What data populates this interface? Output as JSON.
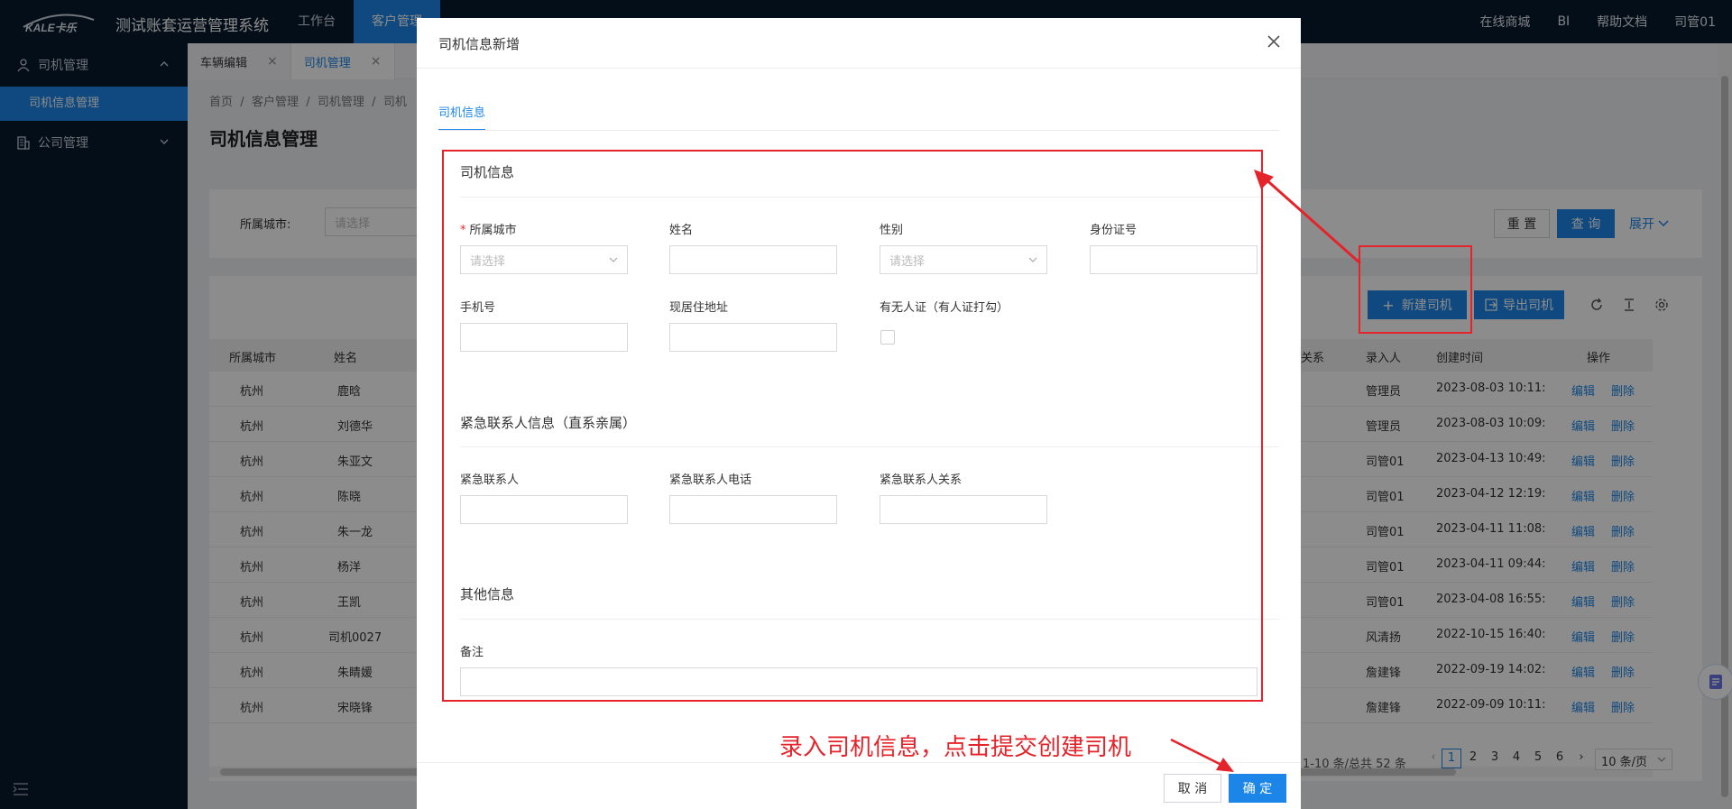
{
  "topbar": {
    "system_title": "测试账套运营管理系统",
    "nav": [
      "工作台",
      "客户管理"
    ],
    "right": [
      "在线商城",
      "BI",
      "帮助文档",
      "司管01"
    ]
  },
  "sidebar": {
    "groups": [
      {
        "label": "司机管理",
        "icon": "user-icon",
        "expanded": true,
        "children": [
          "司机信息管理"
        ]
      },
      {
        "label": "公司管理",
        "icon": "building-icon",
        "expanded": false,
        "children": []
      }
    ]
  },
  "tabs": [
    {
      "label": "车辆编辑",
      "active": false
    },
    {
      "label": "司机管理",
      "active": true
    }
  ],
  "breadcrumb": [
    "首页",
    "客户管理",
    "司机管理",
    "司机"
  ],
  "page_title": "司机信息管理",
  "filter": {
    "city_label": "所属城市:",
    "city_placeholder": "请选择",
    "reset_label": "重 置",
    "query_label": "查 询",
    "expand_label": "展开"
  },
  "toolbar": {
    "new_label": "新建司机",
    "export_label": "导出司机"
  },
  "table": {
    "headers": [
      "所属城市",
      "姓名",
      "关系",
      "录入人",
      "创建时间",
      "操作"
    ],
    "rows": [
      {
        "city": "杭州",
        "name": "鹿晗",
        "creator": "管理员",
        "created": "2023-08-03 10:11:"
      },
      {
        "city": "杭州",
        "name": "刘德华",
        "creator": "管理员",
        "created": "2023-08-03 10:09:"
      },
      {
        "city": "杭州",
        "name": "朱亚文",
        "creator": "司管01",
        "created": "2023-04-13 10:49:"
      },
      {
        "city": "杭州",
        "name": "陈晓",
        "creator": "司管01",
        "created": "2023-04-12 12:19:"
      },
      {
        "city": "杭州",
        "name": "朱一龙",
        "creator": "司管01",
        "created": "2023-04-11 11:08:"
      },
      {
        "city": "杭州",
        "name": "杨洋",
        "creator": "司管01",
        "created": "2023-04-11 09:44:"
      },
      {
        "city": "杭州",
        "name": "王凯",
        "creator": "司管01",
        "created": "2023-04-08 16:55:"
      },
      {
        "city": "杭州",
        "name": "司机0027",
        "creator": "风清扬",
        "created": "2022-10-15 16:40:"
      },
      {
        "city": "杭州",
        "name": "朱睛媛",
        "creator": "詹建锋",
        "created": "2022-09-19 14:02:"
      },
      {
        "city": "杭州",
        "name": "宋晓锋",
        "creator": "詹建锋",
        "created": "2022-09-09 10:11:"
      }
    ],
    "edit_label": "编辑",
    "delete_label": "删除"
  },
  "pagination": {
    "summary": "1-10 条/总共 52 条",
    "pages": [
      "1",
      "2",
      "3",
      "4",
      "5",
      "6"
    ],
    "current": "1",
    "page_size": "10 条/页"
  },
  "modal": {
    "title": "司机信息新增",
    "tab": "司机信息",
    "sections": {
      "driver": "司机信息",
      "emergency": "紧急联系人信息（直系亲属）",
      "other": "其他信息"
    },
    "fields": {
      "city": {
        "label": "所属城市",
        "placeholder": "请选择",
        "required": true
      },
      "name": {
        "label": "姓名"
      },
      "gender": {
        "label": "性别",
        "placeholder": "请选择"
      },
      "id_no": {
        "label": "身份证号"
      },
      "phone": {
        "label": "手机号"
      },
      "address": {
        "label": "现居住地址"
      },
      "cert": {
        "label": "有无人证（有人证打勾）"
      },
      "ec_name": {
        "label": "紧急联系人"
      },
      "ec_phone": {
        "label": "紧急联系人电话"
      },
      "ec_relation": {
        "label": "紧急联系人关系"
      },
      "remark": {
        "label": "备注"
      }
    },
    "cancel_label": "取 消",
    "ok_label": "确 定"
  },
  "annotation": {
    "text": "录入司机信息，点击提交创建司机",
    "color": "#e5232a"
  },
  "colors": {
    "primary": "#1c86e8",
    "nav_bg": "#081a2e"
  }
}
